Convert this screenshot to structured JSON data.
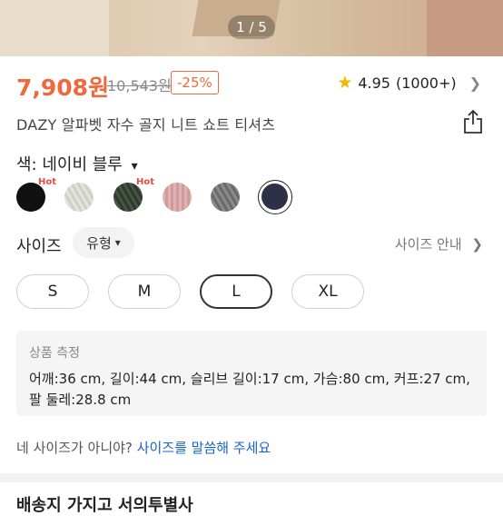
{
  "gallery": {
    "counter": "1 / 5"
  },
  "price": {
    "current": "7,908원",
    "original": "10,543원",
    "discount": "-25%"
  },
  "rating": {
    "score": "4.95",
    "count": "(1000+)"
  },
  "product": {
    "title": "DAZY 알파벳 자수 골지 니트 쇼트 티셔츠"
  },
  "color": {
    "label": "색: 네이비 블루",
    "hot_label": "Hot",
    "swatches": [
      {
        "name": "black",
        "color": "#111111",
        "hot": true
      },
      {
        "name": "light-gray",
        "color": "#d9d9d4",
        "hot": false
      },
      {
        "name": "dark-green",
        "color": "#3c4a3a",
        "hot": true
      },
      {
        "name": "pink",
        "color": "#d9a6a6",
        "hot": false
      },
      {
        "name": "gray",
        "color": "#7a7a7a",
        "hot": false
      },
      {
        "name": "navy-blue",
        "color": "#2c3145",
        "hot": false
      }
    ],
    "selected": "navy-blue"
  },
  "size": {
    "label": "사이즈",
    "type_dropdown": "유형",
    "guide_link": "사이즈 안내",
    "options": [
      "S",
      "M",
      "L",
      "XL"
    ],
    "selected": "L"
  },
  "measurements": {
    "title": "상품 측정",
    "text": "어깨:36 cm, 길이:44 cm, 슬리브 길이:17 cm, 가슴:80 cm, 커프:27 cm, 팔 둘레:28.8 cm"
  },
  "ask": {
    "question": "네 사이즈가 아니야? ",
    "link": "사이즈를 말씀해 주세요"
  },
  "next_section": {
    "title": "배송지 가지고 서의투별사"
  },
  "colors": {
    "accent": "#f0683b",
    "link": "#1a63c9",
    "star": "#f5b400"
  }
}
